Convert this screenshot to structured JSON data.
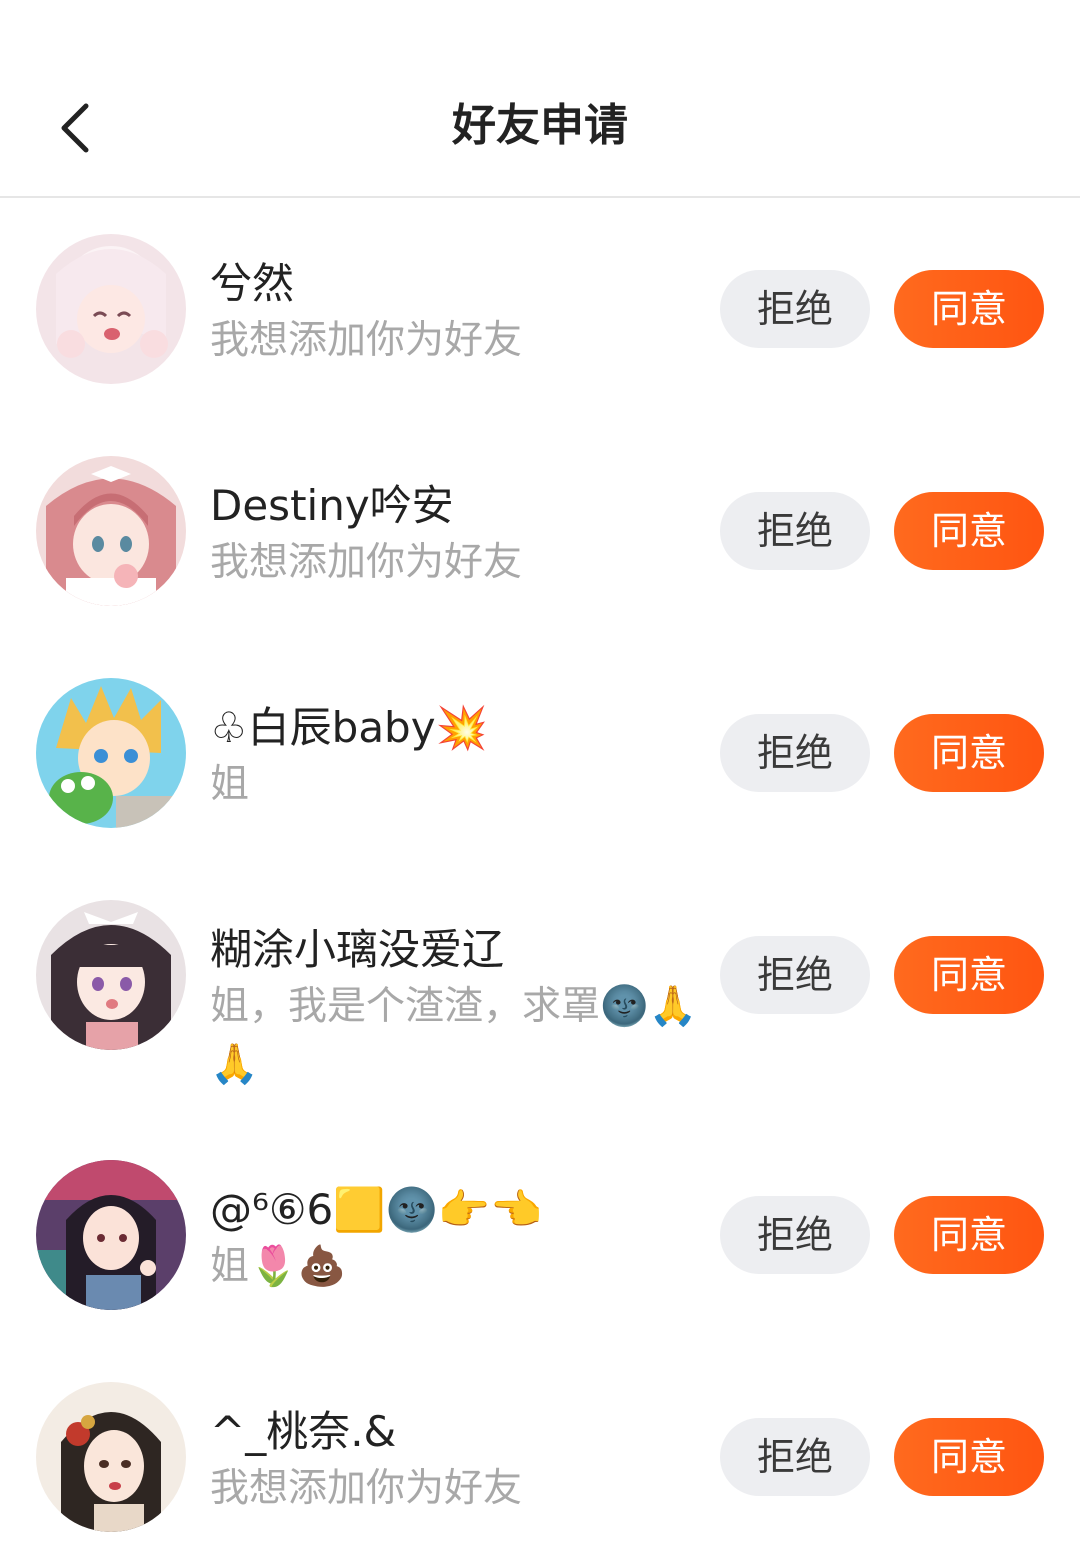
{
  "header": {
    "title": "好友申请",
    "back_icon": "chevron-left-icon"
  },
  "requests": [
    {
      "name": "兮然",
      "message": "我想添加你为好友",
      "reject_label": "拒绝",
      "accept_label": "同意"
    },
    {
      "name": "Destiny吟安",
      "message": "我想添加你为好友",
      "reject_label": "拒绝",
      "accept_label": "同意"
    },
    {
      "name": "♧白辰baby💥",
      "message": "姐",
      "reject_label": "拒绝",
      "accept_label": "同意"
    },
    {
      "name": "糊涂小璃没爱辽",
      "message": "姐，我是个渣渣，求罩🌚🙏🙏",
      "reject_label": "拒绝",
      "accept_label": "同意"
    },
    {
      "name": "@⁶⑥6🟨🌚👉👈",
      "message": "姐🌷💩",
      "reject_label": "拒绝",
      "accept_label": "同意"
    },
    {
      "name": "^_桃奈.&",
      "message": "我想添加你为好友",
      "reject_label": "拒绝",
      "accept_label": "同意"
    }
  ],
  "colors": {
    "accent": "#ff5f1a",
    "reject_bg": "#edeef1",
    "message_text": "#a8a8a8"
  }
}
